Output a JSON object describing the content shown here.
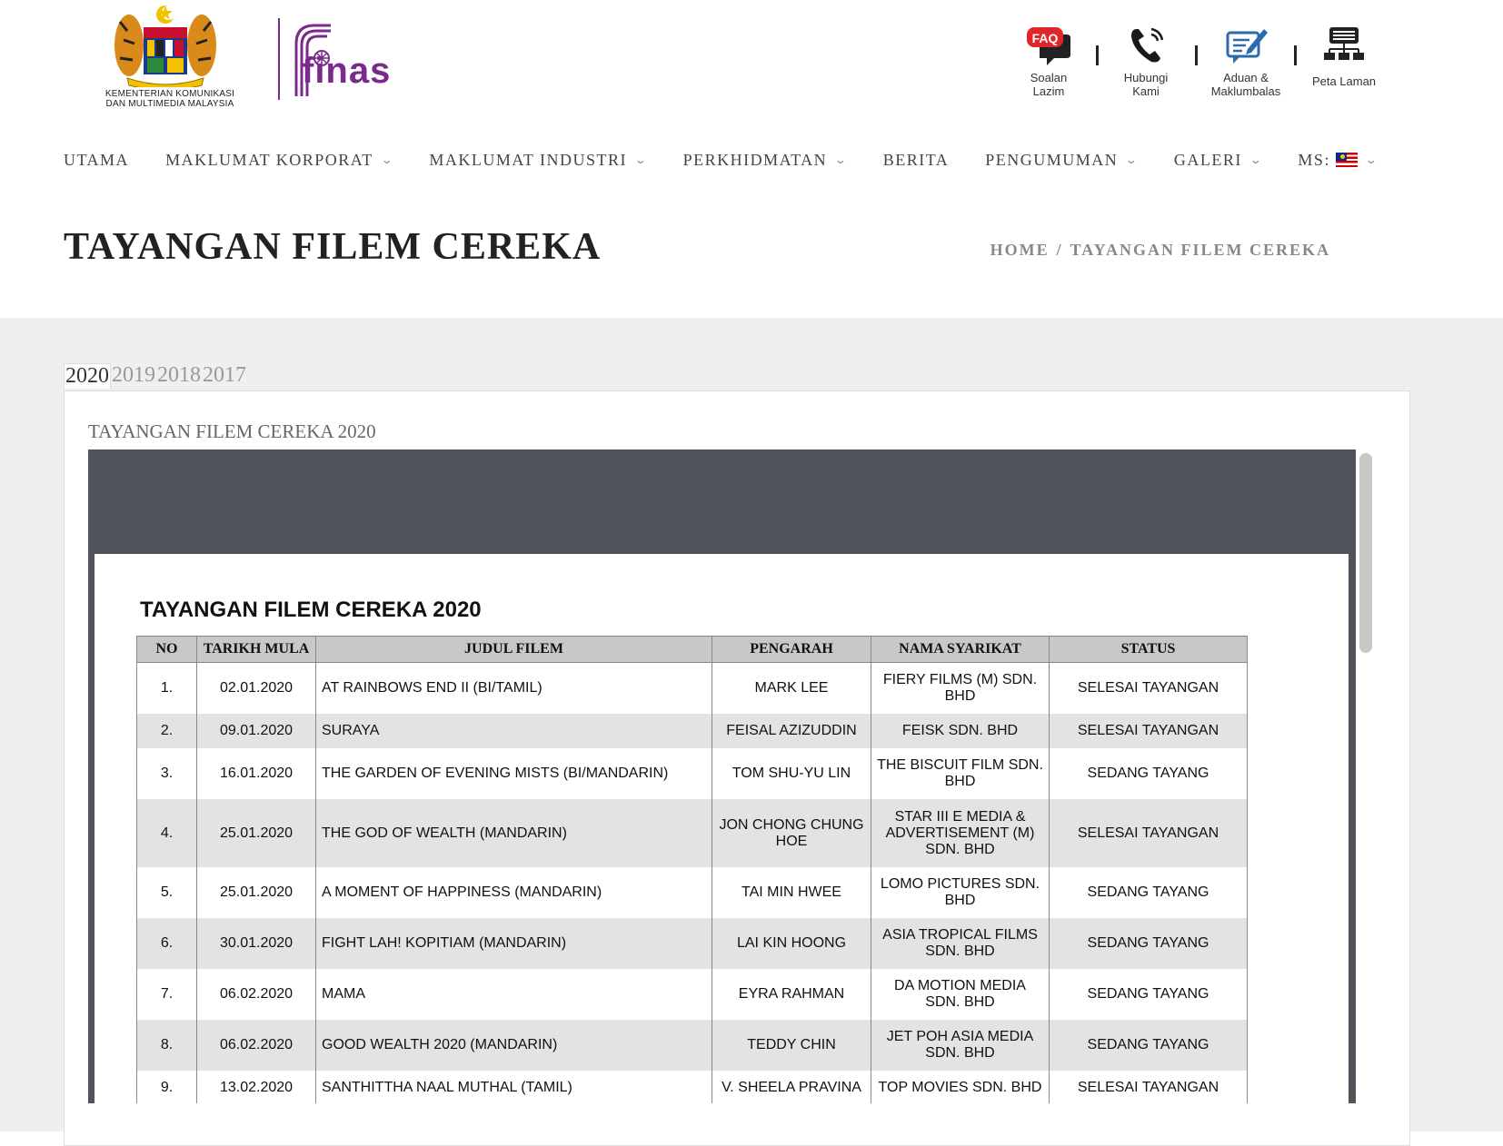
{
  "header": {
    "ministry_line1": "KEMENTERIAN KOMUNIKASI",
    "ministry_line2": "DAN MULTIMEDIA MALAYSIA",
    "finas_logo_text": "finas",
    "quick_links": [
      {
        "icon": "faq-icon",
        "line1": "Soalan",
        "line2": "Lazim"
      },
      {
        "icon": "phone-icon",
        "line1": "Hubungi",
        "line2": "Kami"
      },
      {
        "icon": "feedback-icon",
        "line1": "Aduan &",
        "line2": "Maklumbalas"
      },
      {
        "icon": "sitemap-icon",
        "line1": "Peta Laman",
        "line2": ""
      }
    ],
    "faq_badge": "FAQ"
  },
  "nav": {
    "items": [
      "UTAMA",
      "MAKLUMAT KORPORAT",
      "MAKLUMAT INDUSTRI",
      "PERKHIDMATAN",
      "BERITA",
      "PENGUMUMAN",
      "GALERI",
      "MS:"
    ]
  },
  "page": {
    "title": "TAYANGAN FILEM CEREKA",
    "breadcrumb_home": "HOME",
    "breadcrumb_sep": "/",
    "breadcrumb_current": "TAYANGAN FILEM CEREKA"
  },
  "tabs": [
    "2020",
    "2019",
    "2018",
    "2017"
  ],
  "panel": {
    "title": "TAYANGAN FILEM CEREKA 2020"
  },
  "doc": {
    "title": "TAYANGAN FILEM CEREKA 2020",
    "columns": [
      "NO",
      "TARIKH MULA",
      "JUDUL FILEM",
      "PENGARAH",
      "NAMA SYARIKAT",
      "STATUS"
    ],
    "rows": [
      [
        "1.",
        "02.01.2020",
        "AT RAINBOWS END II (BI/TAMIL)",
        "MARK LEE",
        "FIERY FILMS (M) SDN. BHD",
        "SELESAI TAYANGAN"
      ],
      [
        "2.",
        "09.01.2020",
        "SURAYA",
        "FEISAL AZIZUDDIN",
        "FEISK SDN. BHD",
        "SELESAI TAYANGAN"
      ],
      [
        "3.",
        "16.01.2020",
        "THE GARDEN OF EVENING MISTS (BI/MANDARIN)",
        "TOM SHU-YU LIN",
        "THE BISCUIT FILM SDN. BHD",
        "SEDANG TAYANG"
      ],
      [
        "4.",
        "25.01.2020",
        "THE GOD OF WEALTH (MANDARIN)",
        "JON CHONG CHUNG HOE",
        "STAR III E MEDIA & ADVERTISEMENT (M) SDN. BHD",
        "SELESAI TAYANGAN"
      ],
      [
        "5.",
        "25.01.2020",
        "A MOMENT OF HAPPINESS (MANDARIN)",
        "TAI MIN HWEE",
        "LOMO PICTURES SDN. BHD",
        "SEDANG TAYANG"
      ],
      [
        "6.",
        "30.01.2020",
        "FIGHT LAH! KOPITIAM (MANDARIN)",
        "LAI KIN HOONG",
        "ASIA TROPICAL FILMS SDN. BHD",
        "SEDANG TAYANG"
      ],
      [
        "7.",
        "06.02.2020",
        "MAMA",
        "EYRA RAHMAN",
        "DA MOTION MEDIA SDN. BHD",
        "SEDANG TAYANG"
      ],
      [
        "8.",
        "06.02.2020",
        "GOOD WEALTH 2020 (MANDARIN)",
        "TEDDY CHIN",
        "JET POH ASIA MEDIA SDN. BHD",
        "SEDANG TAYANG"
      ],
      [
        "9.",
        "13.02.2020",
        "SANTHITTHA NAAL MUTHAL (TAMIL)",
        "V. SHEELA PRAVINA",
        "TOP MOVIES SDN. BHD",
        "SELESAI TAYANGAN"
      ]
    ]
  }
}
